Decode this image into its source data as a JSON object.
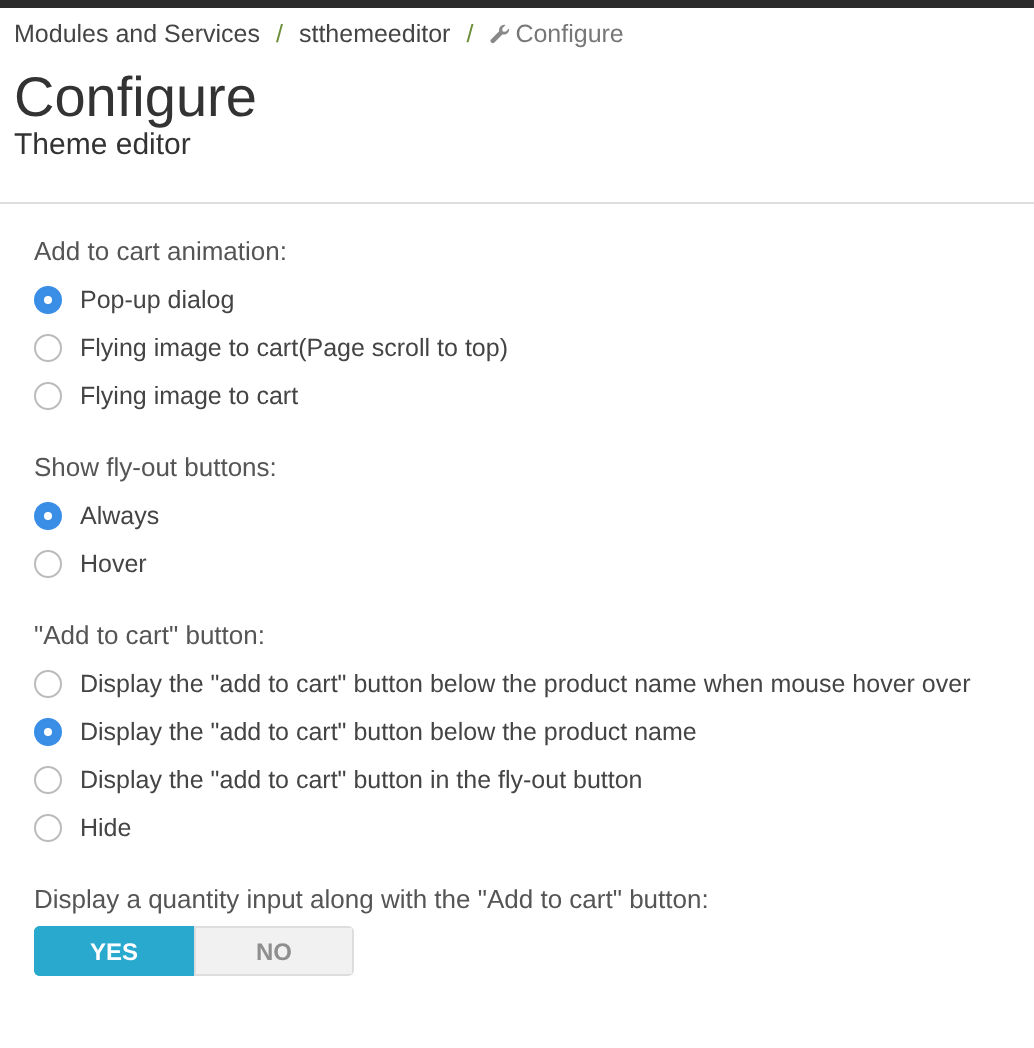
{
  "breadcrumb": [
    {
      "kind": "link",
      "label": "Modules and Services"
    },
    {
      "kind": "link",
      "separator": "/",
      "label": "stthemeeditor"
    },
    {
      "kind": "current",
      "separator": "/",
      "label": "Configure"
    }
  ],
  "header": {
    "title": "Configure",
    "subtitle": "Theme editor"
  },
  "groups": [
    {
      "kind": "radio",
      "label": "Add to cart animation:",
      "options": [
        {
          "label": "Pop-up dialog",
          "selected": true
        },
        {
          "label": "Flying image to cart(Page scroll to top)",
          "selected": false
        },
        {
          "label": "Flying image to cart",
          "selected": false
        }
      ]
    },
    {
      "kind": "radio",
      "label": "Show fly-out buttons:",
      "options": [
        {
          "label": "Always",
          "selected": true
        },
        {
          "label": "Hover",
          "selected": false
        }
      ]
    },
    {
      "kind": "radio",
      "label": "\"Add to cart\" button:",
      "options": [
        {
          "label": "Display the \"add to cart\" button below the product name when mouse hover over",
          "selected": false
        },
        {
          "label": "Display the \"add to cart\" button below the product name",
          "selected": true
        },
        {
          "label": "Display the \"add to cart\" button in the fly-out button",
          "selected": false
        },
        {
          "label": "Hide",
          "selected": false
        }
      ]
    },
    {
      "kind": "switch",
      "label": "Display a quantity input along with the \"Add to cart\" button:",
      "options": [
        {
          "label": "YES",
          "selected": true
        },
        {
          "label": "NO",
          "selected": false
        }
      ]
    }
  ]
}
